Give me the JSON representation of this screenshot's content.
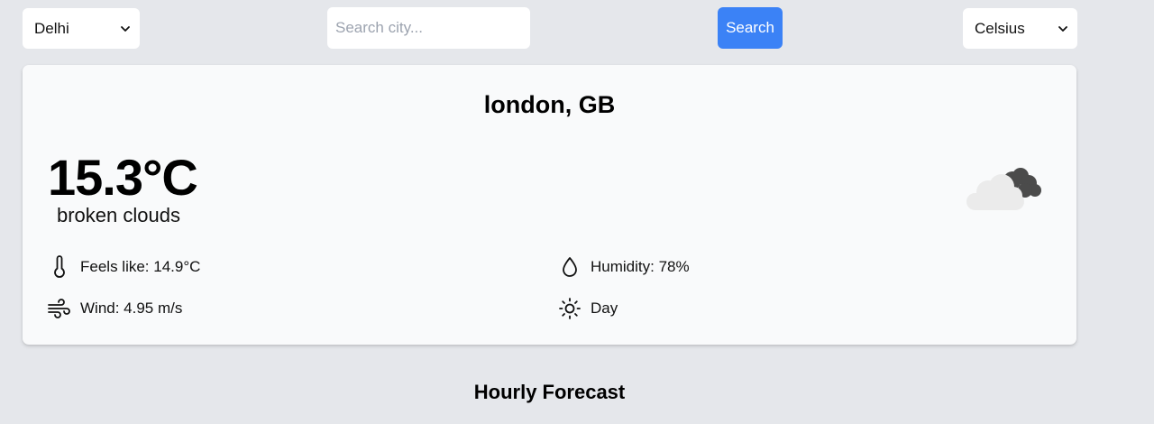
{
  "controls": {
    "city_select": {
      "selected": "Delhi"
    },
    "search": {
      "placeholder": "Search city...",
      "value": ""
    },
    "search_button_label": "Search",
    "unit_select": {
      "selected": "Celsius"
    }
  },
  "weather": {
    "location": "london, GB",
    "temperature": "15.3°C",
    "condition": "broken clouds",
    "icon": "broken-clouds-icon",
    "details": {
      "feels_like": "Feels like: 14.9°C",
      "humidity": "Humidity: 78%",
      "wind": "Wind: 4.95 m/s",
      "day_night": "Day"
    }
  },
  "sections": {
    "hourly_heading": "Hourly Forecast"
  },
  "colors": {
    "background": "#e5e7eb",
    "card": "#f9fafb",
    "accent": "#3b82f6"
  }
}
